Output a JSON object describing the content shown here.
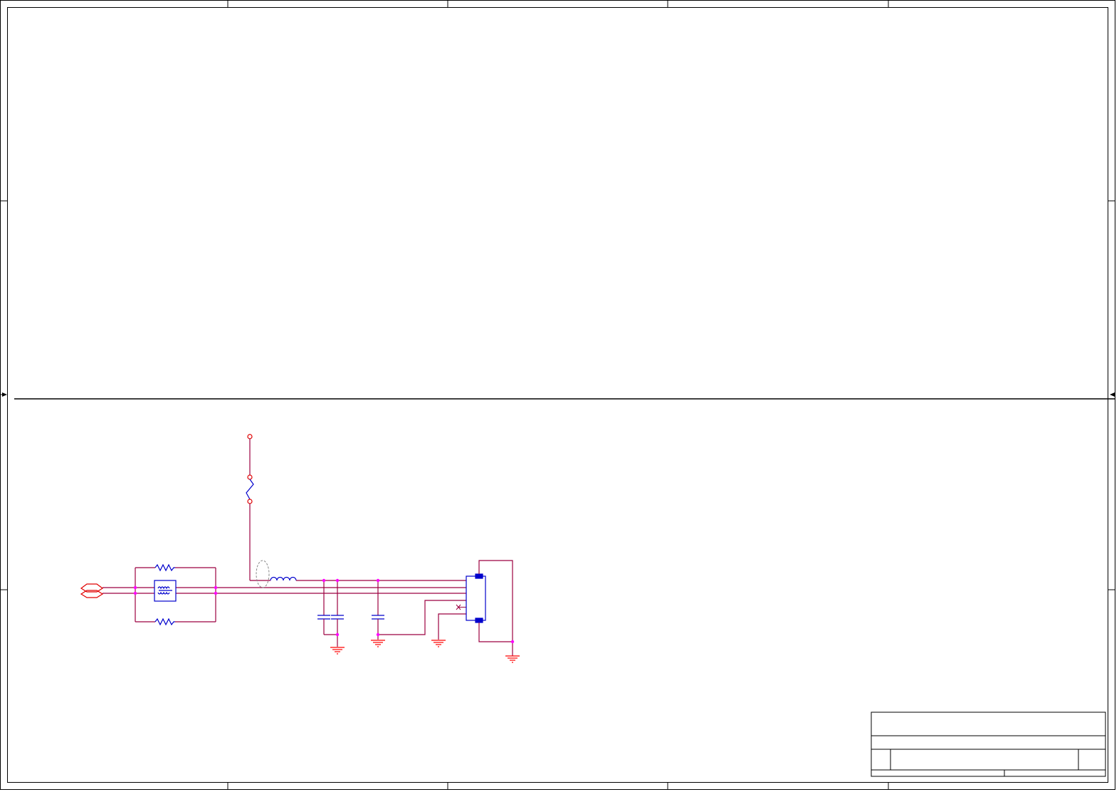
{
  "drawing": {
    "type": "electronic schematic sheet",
    "colors": {
      "border": "#000000",
      "wire": "#9c0040",
      "component": "#0000cc",
      "net_terminal": "#e00000",
      "junction": "#ff00ff",
      "ground": "#ff0000",
      "guide": "#888888"
    },
    "symbols": [
      "zone-ticks-icon",
      "off-page-connector-icon",
      "resistor-icon",
      "common-mode-choke-icon",
      "fuse-icon",
      "inductor-icon",
      "ferrite-loop-icon",
      "capacitor-icon",
      "connector-icon",
      "no-connect-icon",
      "ground-icon",
      "junction-dot-icon",
      "title-block"
    ]
  }
}
